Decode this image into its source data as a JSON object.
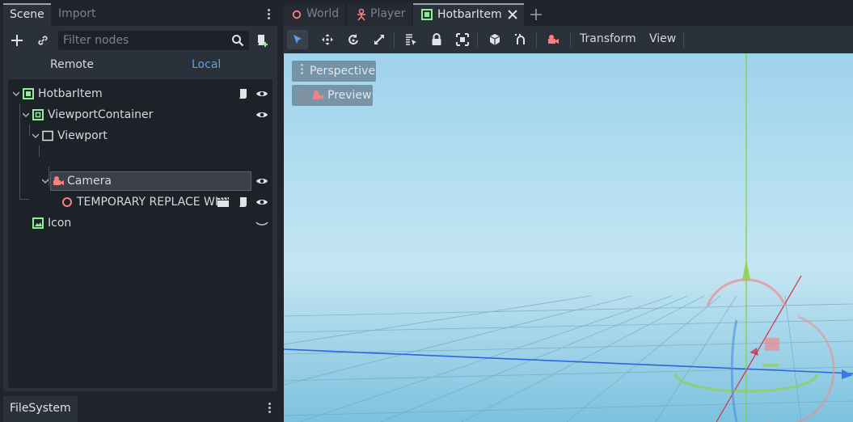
{
  "scene_panel": {
    "tabs": [
      {
        "label": "Scene"
      },
      {
        "label": "Import"
      }
    ],
    "filter_placeholder": "Filter nodes",
    "remote_label": "Remote",
    "local_label": "Local",
    "tree": [
      {
        "label": "HotbarItem",
        "icon": "control-node-icon"
      },
      {
        "label": "ViewportContainer",
        "icon": "viewport-container-icon"
      },
      {
        "label": "Viewport",
        "icon": "viewport-icon"
      },
      {
        "label": "Camera",
        "icon": "camera-icon",
        "selected": true
      },
      {
        "label": "TEMPORARY REPLACE WI",
        "icon": "spatial-node-icon"
      },
      {
        "label": "Icon",
        "icon": "texture-rect-icon"
      }
    ]
  },
  "filesystem_panel": {
    "tab_label": "FileSystem"
  },
  "editor": {
    "scene_tabs": [
      {
        "label": "World",
        "icon": "spatial-node-icon"
      },
      {
        "label": "Player",
        "icon": "kinematic-body-icon"
      },
      {
        "label": "HotbarItem",
        "icon": "control-node-icon",
        "active": true
      }
    ],
    "toolbar": {
      "transform_label": "Transform",
      "view_label": "View"
    },
    "viewport": {
      "perspective_label": "Perspective",
      "preview_label": "Preview"
    }
  },
  "colors": {
    "accent_blue": "#5f9fe6",
    "node_green": "#8eef97",
    "node_red": "#fc7f7f",
    "sky_top": "#9ed3ec",
    "ground": "#7cc2de"
  }
}
